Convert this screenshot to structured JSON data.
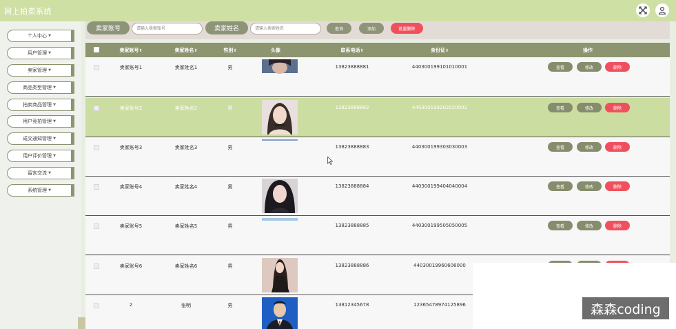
{
  "header": {
    "title": "网上拍卖系统"
  },
  "sidebar": {
    "items": [
      {
        "label": "个人中心"
      },
      {
        "label": "用户管理"
      },
      {
        "label": "卖家管理"
      },
      {
        "label": "商品类型管理"
      },
      {
        "label": "拍卖商品管理"
      },
      {
        "label": "用户竞拍管理"
      },
      {
        "label": "成交通知管理"
      },
      {
        "label": "用户评价管理"
      },
      {
        "label": "留言交流"
      },
      {
        "label": "系统管理"
      }
    ]
  },
  "search": {
    "account_label": "卖家账号",
    "account_placeholder": "请输入卖家账号",
    "name_label": "卖家姓名",
    "name_placeholder": "请输入卖家姓名",
    "query_btn": "查询",
    "add_btn": "添加",
    "batch_delete_btn": "批量删除"
  },
  "table": {
    "columns": [
      "卖家账号",
      "卖家姓名",
      "性别",
      "头像",
      "联系电话",
      "身份证",
      "操作"
    ],
    "sort_columns": [
      true,
      true,
      true,
      false,
      true,
      true,
      false
    ],
    "rows": [
      {
        "account": "卖家账号1",
        "name": "卖家姓名1",
        "gender": "男",
        "phone": "13823888881",
        "id_card": "440300199101010001",
        "avatar_style": "dark-hair-crop"
      },
      {
        "account": "卖家账号2",
        "name": "卖家姓名2",
        "gender": "男",
        "phone": "13823888882",
        "id_card": "440300199202020002",
        "avatar_style": "woman-choker"
      },
      {
        "account": "卖家账号3",
        "name": "卖家姓名3",
        "gender": "男",
        "phone": "13823888883",
        "id_card": "440300199303030003",
        "avatar_style": "thin-strip"
      },
      {
        "account": "卖家账号4",
        "name": "卖家姓名4",
        "gender": "男",
        "phone": "13823888884",
        "id_card": "440300199404040004",
        "avatar_style": "woman-dark-hair"
      },
      {
        "account": "卖家账号5",
        "name": "卖家姓名5",
        "gender": "男",
        "phone": "13823888885",
        "id_card": "440300199505050005",
        "avatar_style": "light-strip"
      },
      {
        "account": "卖家账号6",
        "name": "卖家姓名6",
        "gender": "男",
        "phone": "13823888886",
        "id_card": "44030019960606000",
        "avatar_style": "woman-full"
      },
      {
        "account": "2",
        "name": "张明",
        "gender": "男",
        "phone": "13812345678",
        "id_card": "12365478974125896",
        "avatar_style": "man-suit"
      }
    ],
    "actions": {
      "view": "查看",
      "edit": "修改",
      "delete": "删除"
    }
  },
  "watermark": "森森coding",
  "colors": {
    "header": "#cfe0a5",
    "accent": "#8c9470",
    "danger": "#f0505d",
    "highlight_row": "#cbdda1"
  }
}
